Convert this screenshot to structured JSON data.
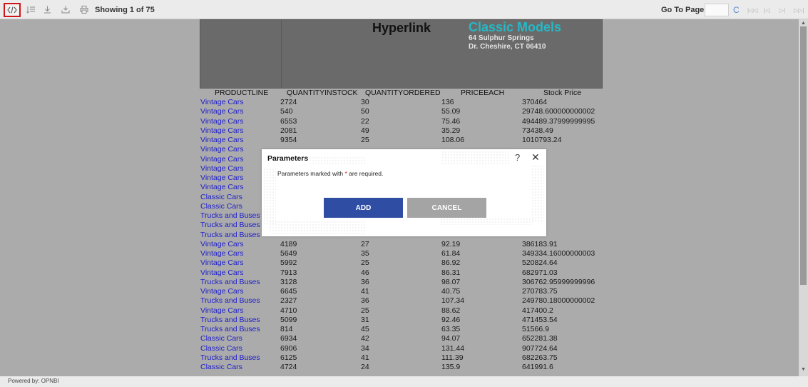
{
  "toolbar": {
    "showing": "Showing 1 of 75",
    "goto_label": "Go To Page :",
    "goto_value": "",
    "icons": [
      "code-icon",
      "list-icon",
      "download-icon",
      "export-icon",
      "print-icon",
      "refresh-icon",
      "first-page-icon",
      "prev-page-icon",
      "next-page-icon",
      "last-page-icon"
    ],
    "nav": {
      "first": "|◁◁",
      "prev": "|◁",
      "next": "▷|",
      "last": "▷▷|"
    },
    "refresh": "C"
  },
  "report": {
    "title": "Hyperlink",
    "company": "Classic Models",
    "address_line1": "64 Sulphur Springs",
    "address_line2": "Dr. Cheshire, CT 06410",
    "colors": {
      "company": "#25b9c6",
      "link": "#1d1dcc",
      "header_bg": "#6a6a6a"
    },
    "columns": [
      "PRODUCTLINE",
      "QUANTITYINSTOCK",
      "QUANTITYORDERED",
      "PRICEEACH",
      "Stock Price"
    ],
    "rows": [
      [
        "Vintage Cars",
        "2724",
        "30",
        "136",
        "370464"
      ],
      [
        "Vintage Cars",
        "540",
        "50",
        "55.09",
        "29748.600000000002"
      ],
      [
        "Vintage Cars",
        "6553",
        "22",
        "75.46",
        "494489.37999999995"
      ],
      [
        "Vintage Cars",
        "2081",
        "49",
        "35.29",
        "73438.49"
      ],
      [
        "Vintage Cars",
        "9354",
        "25",
        "108.06",
        "1010793.24"
      ],
      [
        "Vintage Cars",
        "",
        "",
        "",
        ""
      ],
      [
        "Vintage Cars",
        "",
        "",
        "",
        ""
      ],
      [
        "Vintage Cars",
        "",
        "",
        "",
        ""
      ],
      [
        "Vintage Cars",
        "",
        "",
        "",
        ""
      ],
      [
        "Vintage Cars",
        "",
        "",
        "",
        ""
      ],
      [
        "Classic Cars",
        "",
        "",
        "",
        ""
      ],
      [
        "Classic Cars",
        "",
        "",
        "",
        ""
      ],
      [
        "Trucks and Buses",
        "",
        "",
        "",
        ""
      ],
      [
        "Trucks and Buses",
        "",
        "",
        "",
        ""
      ],
      [
        "Trucks and Buses",
        "",
        "",
        "",
        ""
      ],
      [
        "Vintage Cars",
        "4189",
        "27",
        "92.19",
        "386183.91"
      ],
      [
        "Vintage Cars",
        "5649",
        "35",
        "61.84",
        "349334.16000000003"
      ],
      [
        "Vintage Cars",
        "5992",
        "25",
        "86.92",
        "520824.64"
      ],
      [
        "Vintage Cars",
        "7913",
        "46",
        "86.31",
        "682971.03"
      ],
      [
        "Trucks and Buses",
        "3128",
        "36",
        "98.07",
        "306762.95999999996"
      ],
      [
        "Vintage Cars",
        "6645",
        "41",
        "40.75",
        "270783.75"
      ],
      [
        "Trucks and Buses",
        "2327",
        "36",
        "107.34",
        "249780.18000000002"
      ],
      [
        "Vintage Cars",
        "4710",
        "25",
        "88.62",
        "417400.2"
      ],
      [
        "Trucks and Buses",
        "5099",
        "31",
        "92.46",
        "471453.54"
      ],
      [
        "Trucks and Buses",
        "814",
        "45",
        "63.35",
        "51566.9"
      ],
      [
        "Classic Cars",
        "6934",
        "42",
        "94.07",
        "652281.38"
      ],
      [
        "Classic Cars",
        "6906",
        "34",
        "131.44",
        "907724.64"
      ],
      [
        "Trucks and Buses",
        "6125",
        "41",
        "111.39",
        "682263.75"
      ],
      [
        "Classic Cars",
        "4724",
        "24",
        "135.9",
        "641991.6"
      ]
    ]
  },
  "dialog": {
    "title": "Parameters",
    "help": "?",
    "close": "✕",
    "message_before": "Parameters marked with ",
    "required_mark": "*",
    "message_after": " are required.",
    "add_label": "ADD",
    "cancel_label": "CANCEL",
    "colors": {
      "add": "#2f4ea3",
      "cancel": "#a4a4a4"
    }
  },
  "footer": {
    "powered_by": "Powered by: OPNBI"
  }
}
